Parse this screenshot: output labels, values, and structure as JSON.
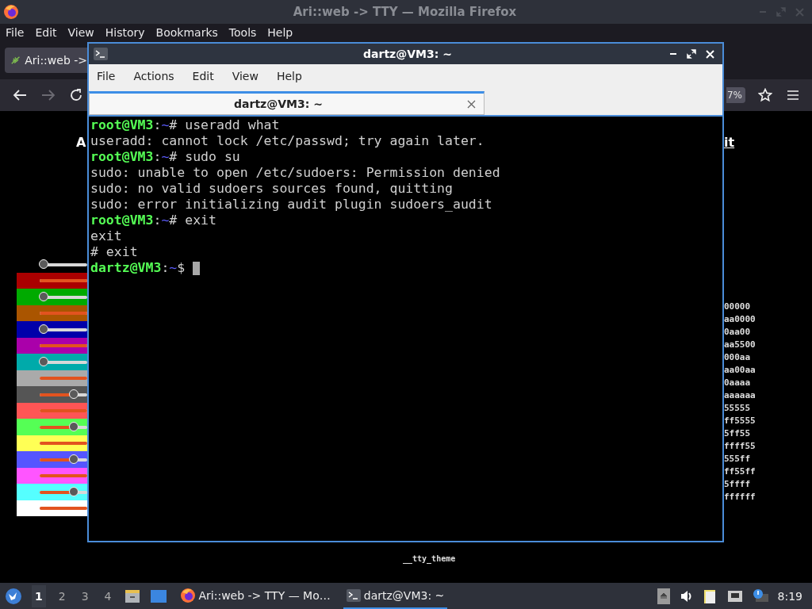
{
  "browser": {
    "title": "Ari::web -> TTY — Mozilla Firefox",
    "menu": [
      "File",
      "Edit",
      "View",
      "History",
      "Bookmarks",
      "Tools",
      "Help"
    ],
    "tab": {
      "label": "Ari::web ->"
    },
    "nav": {
      "back_disabled": false,
      "forward_disabled": true,
      "zoom": "7%"
    },
    "page": {
      "heading_left": "A",
      "heading_right": "it",
      "footer": "__tty_theme",
      "swatches": [
        {
          "color": "#000000",
          "level": 0.08
        },
        {
          "color": "#aa0000",
          "level": 1
        },
        {
          "color": "#00aa00",
          "level": 0.08
        },
        {
          "color": "#aa5500",
          "level": 1
        },
        {
          "color": "#0000aa",
          "level": 0.08
        },
        {
          "color": "#aa00aa",
          "level": 1
        },
        {
          "color": "#00aaaa",
          "level": 0.08
        },
        {
          "color": "#aaaaaa",
          "level": 1
        },
        {
          "color": "#555555",
          "level": 0.72
        },
        {
          "color": "#ff5555",
          "level": 1
        },
        {
          "color": "#55ff55",
          "level": 0.72
        },
        {
          "color": "#ffff55",
          "level": 1
        },
        {
          "color": "#5555ff",
          "level": 0.72
        },
        {
          "color": "#ff55ff",
          "level": 1
        },
        {
          "color": "#55ffff",
          "level": 0.72
        },
        {
          "color": "#ffffff",
          "level": 1
        }
      ],
      "hex_values": [
        "00000",
        "aa0000",
        "0aa00",
        "aa5500",
        "000aa",
        "aa00aa",
        "0aaaa",
        "aaaaaa",
        "55555",
        "ff5555",
        "5ff55",
        "ffff55",
        "555ff",
        "ff55ff",
        "5ffff",
        "ffffff"
      ]
    }
  },
  "terminal": {
    "title": "dartz@VM3: ~",
    "menu": [
      "File",
      "Actions",
      "Edit",
      "View",
      "Help"
    ],
    "tab": {
      "label": "dartz@VM3: ~",
      "selected": true
    },
    "lines": [
      {
        "segments": [
          {
            "text": "root@VM3",
            "color": "#55ff55",
            "bold": true
          },
          {
            "text": ":",
            "color": "#d0d0d0"
          },
          {
            "text": "~",
            "color": "#5c5cff"
          },
          {
            "text": "# useradd what",
            "color": "#d0d0d0"
          }
        ]
      },
      {
        "segments": [
          {
            "text": "useradd: cannot lock /etc/passwd; try again later.",
            "color": "#d0d0d0"
          }
        ]
      },
      {
        "segments": [
          {
            "text": "root@VM3",
            "color": "#55ff55",
            "bold": true
          },
          {
            "text": ":",
            "color": "#d0d0d0"
          },
          {
            "text": "~",
            "color": "#5c5cff"
          },
          {
            "text": "# sudo su",
            "color": "#d0d0d0"
          }
        ]
      },
      {
        "segments": [
          {
            "text": "sudo: unable to open /etc/sudoers: Permission denied",
            "color": "#d0d0d0"
          }
        ]
      },
      {
        "segments": [
          {
            "text": "sudo: no valid sudoers sources found, quitting",
            "color": "#d0d0d0"
          }
        ]
      },
      {
        "segments": [
          {
            "text": "sudo: error initializing audit plugin sudoers_audit",
            "color": "#d0d0d0"
          }
        ]
      },
      {
        "segments": [
          {
            "text": "root@VM3",
            "color": "#55ff55",
            "bold": true
          },
          {
            "text": ":",
            "color": "#d0d0d0"
          },
          {
            "text": "~",
            "color": "#5c5cff"
          },
          {
            "text": "# exit",
            "color": "#d0d0d0"
          }
        ]
      },
      {
        "segments": [
          {
            "text": "exit",
            "color": "#d0d0d0"
          }
        ]
      },
      {
        "segments": [
          {
            "text": "# exit",
            "color": "#d0d0d0"
          }
        ]
      },
      {
        "segments": [
          {
            "text": "dartz@VM3",
            "color": "#55ff55",
            "bold": true
          },
          {
            "text": ":",
            "color": "#d0d0d0"
          },
          {
            "text": "~",
            "color": "#5c5cff"
          },
          {
            "text": "$",
            "color": "#d0d0d0"
          }
        ],
        "cursor": true
      }
    ]
  },
  "taskbar": {
    "workspaces": [
      {
        "label": "1",
        "selected": true
      },
      {
        "label": "2",
        "selected": false
      },
      {
        "label": "3",
        "selected": false
      },
      {
        "label": "4",
        "selected": false
      }
    ],
    "tasks": [
      {
        "kind": "browser",
        "label": "Ari::web -> TTY — Mo…",
        "selected": false
      },
      {
        "kind": "terminal",
        "label": "dartz@VM3: ~",
        "selected": true
      }
    ],
    "clock": "8:19"
  }
}
